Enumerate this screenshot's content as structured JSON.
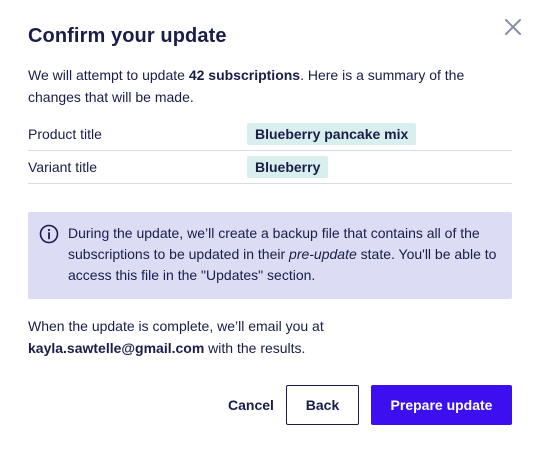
{
  "dialog": {
    "title": "Confirm your update",
    "close_icon": "close-icon",
    "intro": {
      "before": "We will attempt to update ",
      "count_bold": "42 subscriptions",
      "after": ". Here is a summary of the changes that will be made."
    },
    "changes": [
      {
        "label": "Product title",
        "value": "Blueberry pancake mix"
      },
      {
        "label": "Variant title",
        "value": "Blueberry"
      }
    ],
    "notice": {
      "icon": "info-icon",
      "text_before": "During the update, we’ll create a backup file that contains all of the subscriptions to be updated in their ",
      "text_italic": "pre-update",
      "text_after": " state. You'll be able to access this file in the \"Updates\" section."
    },
    "completion": {
      "line1": "When the update is complete, we’ll email you at",
      "email": "kayla.sawtelle@gmail.com",
      "line2": " with the results."
    },
    "actions": {
      "cancel_label": "Cancel",
      "back_label": "Back",
      "primary_label": "Prepare update"
    }
  },
  "colors": {
    "text": "#191d48",
    "primary": "#3b0ff0",
    "value_badge_bg": "#d9efee",
    "notice_bg": "#dcdcf4",
    "divider": "#d9dbe3"
  }
}
